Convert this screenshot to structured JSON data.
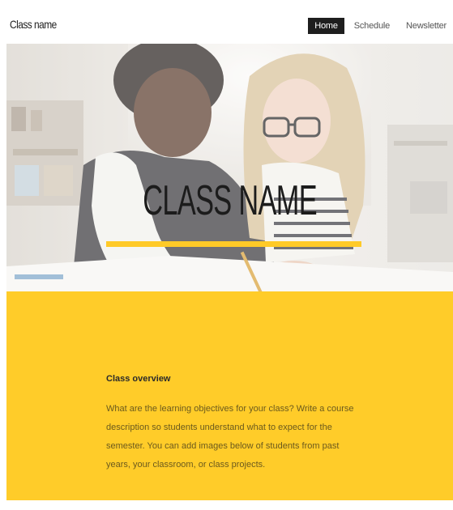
{
  "nav": {
    "site_title": "Class name",
    "links": [
      {
        "label": "Home",
        "active": true
      },
      {
        "label": "Schedule",
        "active": false
      },
      {
        "label": "Newsletter",
        "active": false
      }
    ]
  },
  "hero": {
    "title": "CLASS NAME",
    "accent_color": "#ffca28"
  },
  "overview": {
    "heading": "Class overview",
    "body": "What are the learning objectives for your class? Write a course description so students understand what to expect for the semester. You can add images below of students from past years, your classroom, or class projects.",
    "background_color": "#ffcc29"
  }
}
